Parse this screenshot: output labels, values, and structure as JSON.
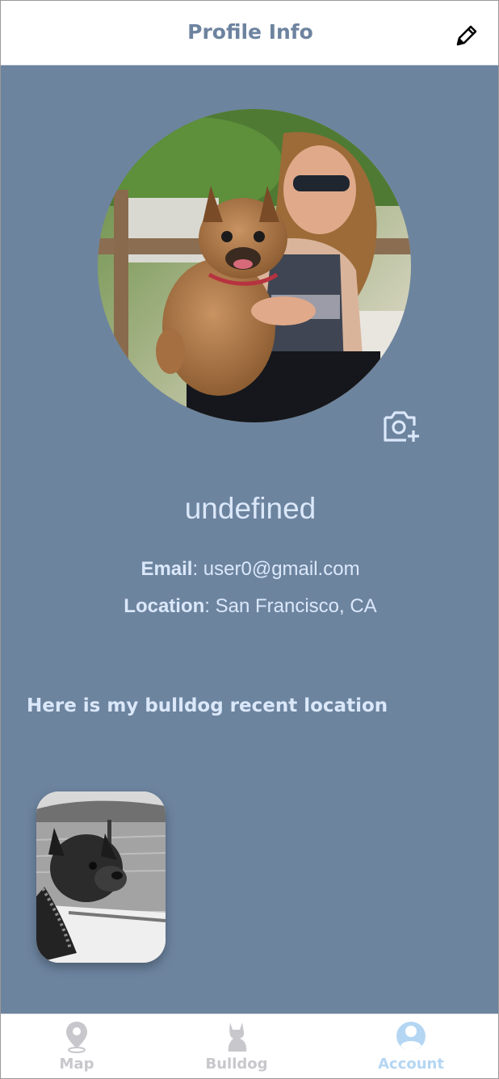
{
  "header": {
    "title": "Profile Info",
    "edit_icon": "pencil-icon"
  },
  "profile": {
    "photo_alt": "woman holding a french bulldog",
    "camera_icon": "camera-plus-icon",
    "name": "undefined",
    "email_label": "Email",
    "email_value": ": user0@gmail.com",
    "location_label": "Location",
    "location_value": ": San Francisco, CA"
  },
  "recent": {
    "heading": "Here is my bulldog recent location",
    "photo_alt": "black and white photo of bulldog on a boat"
  },
  "tabbar": {
    "active": "Account",
    "tabs": [
      {
        "label": "Map",
        "icon": "map-pin-icon",
        "color": "#c7c7cc"
      },
      {
        "label": "Bulldog",
        "icon": "bulldog-icon",
        "color": "#c7c7cc"
      },
      {
        "label": "Account",
        "icon": "account-icon",
        "color": "#b4d6f3"
      }
    ]
  },
  "colors": {
    "background": "#6d849f",
    "header_title": "#6d839f",
    "text_light": "#dbe8fa",
    "active_tab": "#b4d6f3",
    "inactive_tab": "#c7c7cc"
  }
}
